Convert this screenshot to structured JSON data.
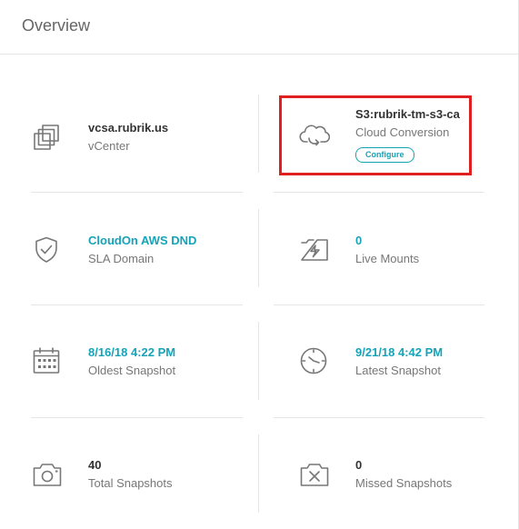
{
  "header": {
    "title": "Overview"
  },
  "cells": {
    "vcenter": {
      "value": "vcsa.rubrik.us",
      "label": "vCenter",
      "icon": "vcenter-icon"
    },
    "cloud": {
      "value": "S3:rubrik-tm-s3-ca",
      "label": "Cloud Conversion",
      "button": "Configure",
      "icon": "cloud-conversion-icon"
    },
    "sla": {
      "value": "CloudOn AWS DND",
      "label": "SLA Domain",
      "icon": "shield-check-icon"
    },
    "live_mounts": {
      "value": "0",
      "label": "Live Mounts",
      "icon": "live-mount-icon"
    },
    "oldest": {
      "value": "8/16/18 4:22 PM",
      "label": "Oldest Snapshot",
      "icon": "calendar-icon"
    },
    "latest": {
      "value": "9/21/18 4:42 PM",
      "label": "Latest Snapshot",
      "icon": "clock-icon"
    },
    "total": {
      "value": "40",
      "label": "Total Snapshots",
      "icon": "camera-icon"
    },
    "missed": {
      "value": "0",
      "label": "Missed Snapshots",
      "icon": "missed-snapshot-icon"
    }
  },
  "colors": {
    "accent": "#16a3b8",
    "highlight": "#e02020",
    "text": "#333333",
    "muted": "#777777"
  }
}
